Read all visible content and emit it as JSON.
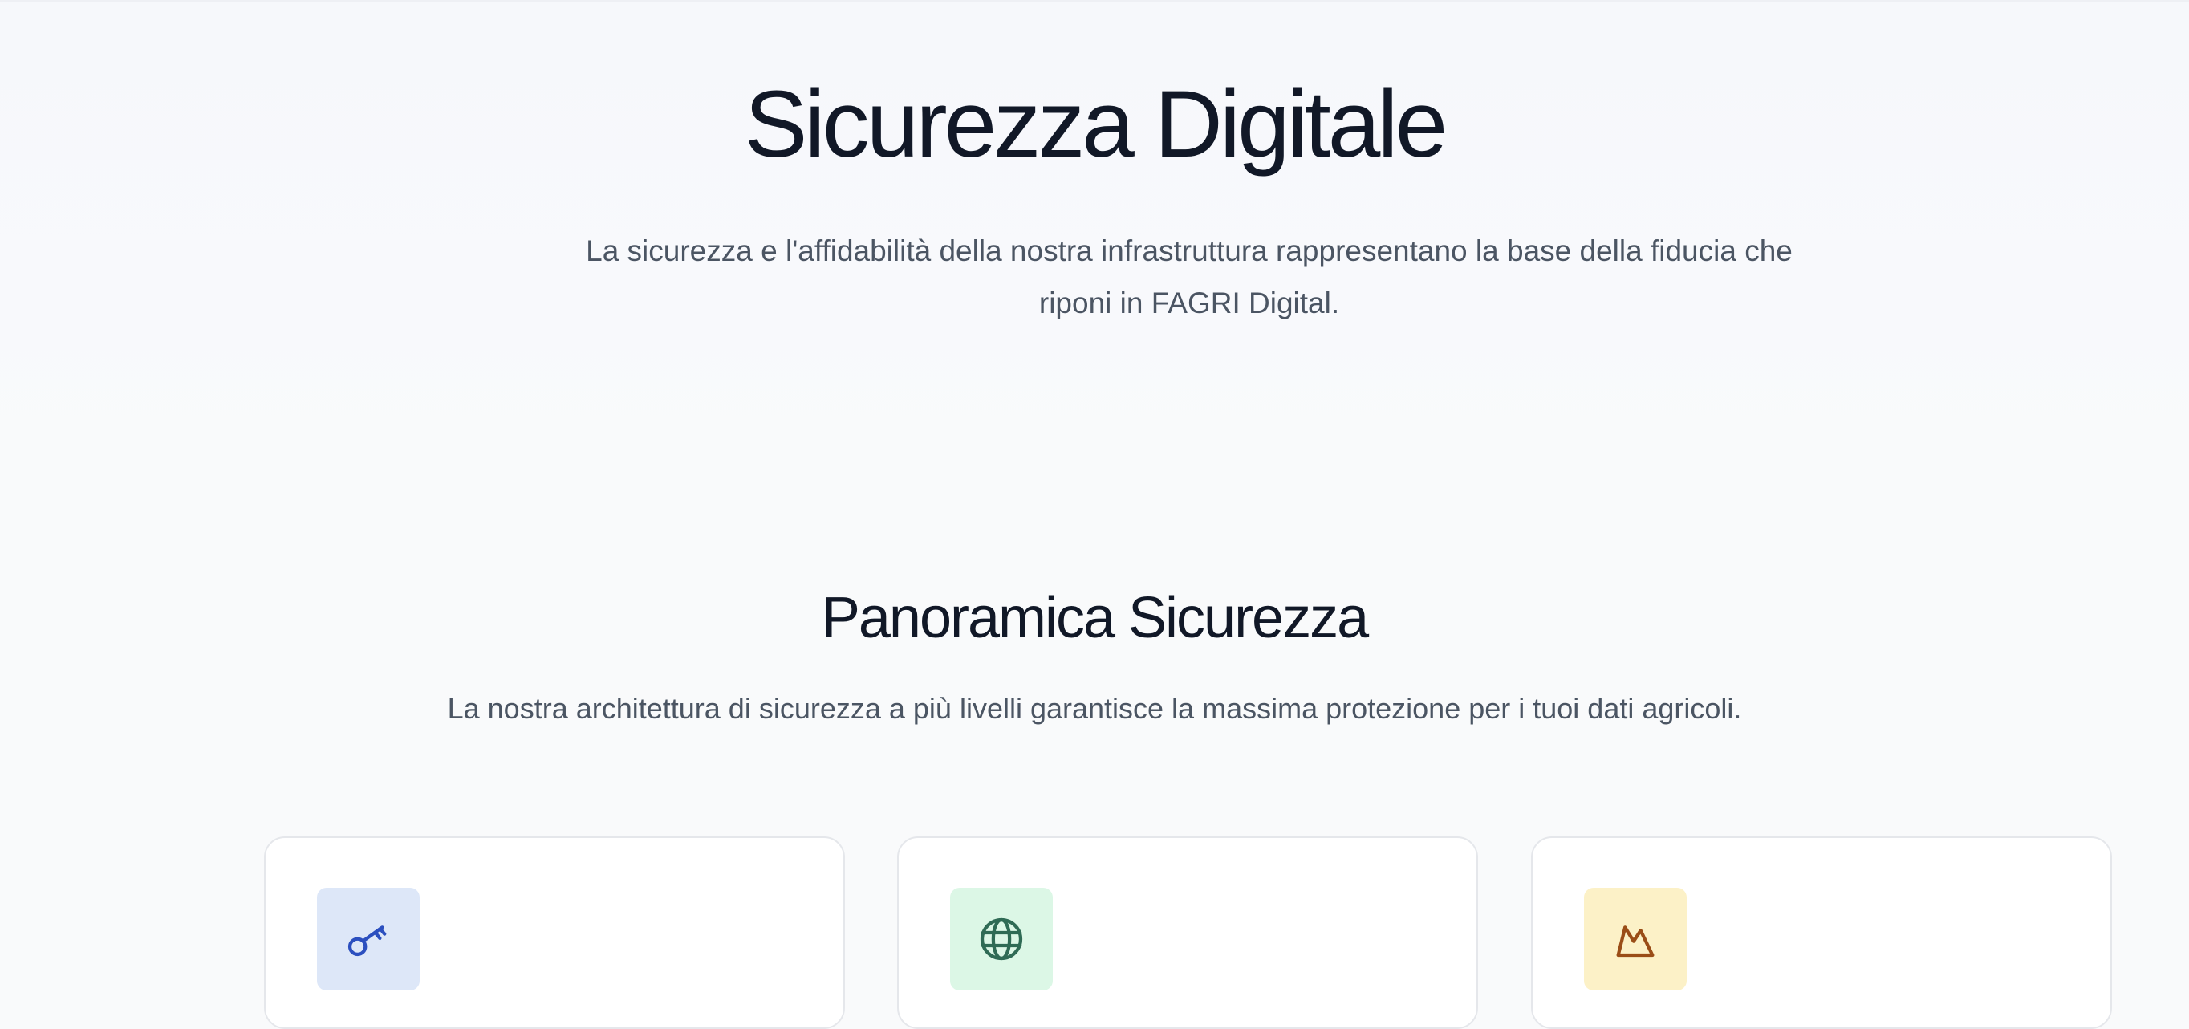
{
  "hero": {
    "title": "Sicurezza Digitale",
    "subtitle": "La sicurezza e l'affidabilità della nostra infrastruttura rappresentano la base della fiducia che riponi in FAGRI Digital."
  },
  "overview": {
    "title": "Panoramica Sicurezza",
    "subtitle": "La nostra architettura di sicurezza a più livelli garantisce la massima protezione per i tuoi dati agricoli."
  },
  "cards": [
    {
      "icon": "key-icon",
      "icon_bg": "#dde7f8",
      "icon_color": "#2b4fbf"
    },
    {
      "icon": "globe-icon",
      "icon_bg": "#dcf7e6",
      "icon_color": "#2f6b55"
    },
    {
      "icon": "mountain-icon",
      "icon_bg": "#fcf1c7",
      "icon_color": "#9a4d17"
    }
  ],
  "colors": {
    "heading": "#111827",
    "body_text": "#4b5563",
    "page_bg": "#f9fafb",
    "card_border": "#e5e7eb"
  }
}
